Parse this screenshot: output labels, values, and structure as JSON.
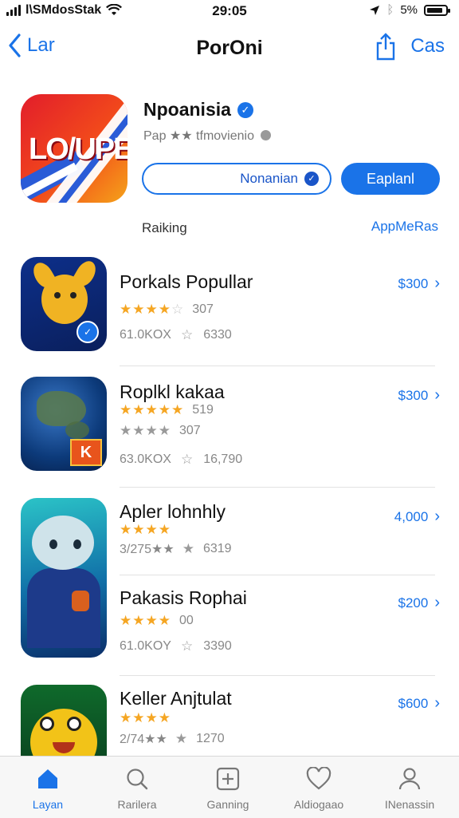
{
  "status_bar": {
    "carrier": "l\\SMdosStak",
    "time": "29:05",
    "battery": "5%",
    "battery_level": 0.85
  },
  "nav": {
    "back_label": "Lar",
    "title": "PorOni",
    "right_label": "Cas"
  },
  "featured": {
    "icon_text": "LO/UPE",
    "name": "Npoanisia",
    "subtitle": "Pap ★★ tfmovienio",
    "secondary_button": "Nonanian",
    "primary_button": "Eaplanl",
    "section_label": "Raiking",
    "section_link": "AppMeRas"
  },
  "apps": [
    {
      "name": "Porkals Popullar",
      "price": "$300",
      "rating_stars": 3.5,
      "rating_text": "307",
      "meta_left": "61.0KOX",
      "meta_right": "6330",
      "icon": "fox-creature-icon"
    },
    {
      "name": "Roplkl kakaa",
      "price": "$300",
      "rating_stars": 4.5,
      "rating_text": "519",
      "extra_stars": 3,
      "extra_text": "307",
      "meta_left": "63.0KOX",
      "meta_right": "16,790",
      "icon": "globe-icon"
    },
    {
      "name": "Apler lohnhly",
      "price": "4,000",
      "rating_stars": 3.5,
      "rating_text": "",
      "meta_left": "3/275★★",
      "meta_right": "6319",
      "icon": "alien-character-icon"
    },
    {
      "name": "Pakasis Rophai",
      "price": "$200",
      "rating_stars": 4,
      "rating_text": "00",
      "meta_left": "61.0KOY",
      "meta_right": "3390",
      "icon": ""
    },
    {
      "name": "Keller Anjtulat",
      "price": "$600",
      "rating_stars": 3.5,
      "rating_text": "",
      "meta_left": "2/74★★",
      "meta_right": "1270",
      "icon": "yellow-chick-icon"
    }
  ],
  "tabs": [
    {
      "label": "Layan",
      "icon": "home-icon",
      "active": true
    },
    {
      "label": "Rarilera",
      "icon": "search-icon",
      "active": false
    },
    {
      "label": "Ganning",
      "icon": "plus-square-icon",
      "active": false
    },
    {
      "label": "Aldiogaao",
      "icon": "heart-icon",
      "active": false
    },
    {
      "label": "INenassin",
      "icon": "person-icon",
      "active": false
    }
  ]
}
